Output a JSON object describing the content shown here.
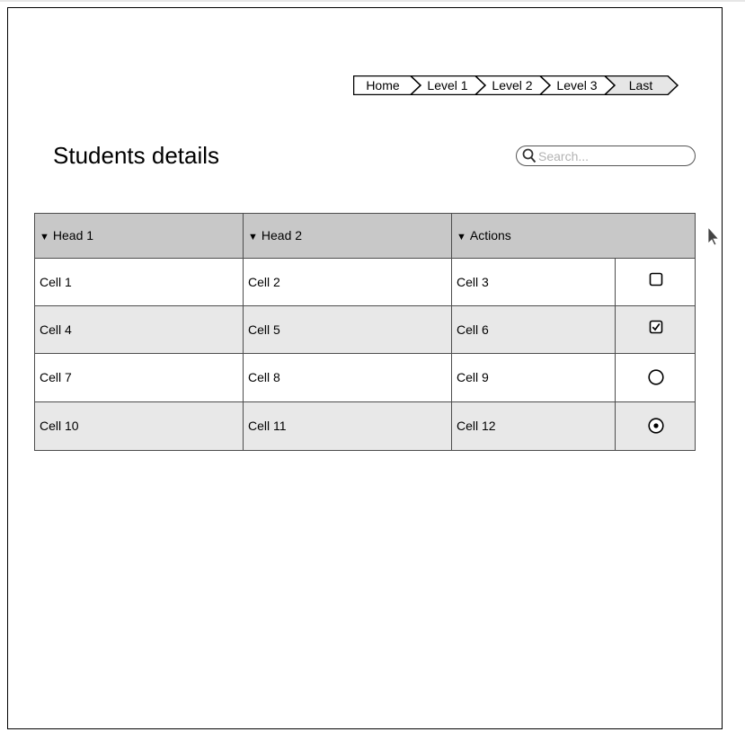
{
  "breadcrumb": {
    "items": [
      "Home",
      "Level 1",
      "Level 2",
      "Level 3",
      "Last"
    ]
  },
  "page": {
    "title": "Students details"
  },
  "search": {
    "placeholder": "Search...",
    "icon": "search-icon"
  },
  "table": {
    "headers": [
      "Head 1",
      "Head 2",
      "Actions"
    ],
    "header_icon": "sort-caret-icon",
    "rows": [
      {
        "cells": [
          "Cell 1",
          "Cell 2",
          "Cell 3"
        ],
        "control": "checkbox",
        "checked": false
      },
      {
        "cells": [
          "Cell 4",
          "Cell 5",
          "Cell 6"
        ],
        "control": "checkbox",
        "checked": true
      },
      {
        "cells": [
          "Cell 7",
          "Cell 8",
          "Cell 9"
        ],
        "control": "radio",
        "checked": false
      },
      {
        "cells": [
          "Cell 10",
          "Cell 11",
          "Cell 12"
        ],
        "control": "radio",
        "checked": true
      }
    ]
  },
  "colors": {
    "header_bg": "#c8c8c8",
    "alt_row_bg": "#e8e8e8",
    "border": "#4d4d4d",
    "last_crumb_bg": "#e6e6e6"
  }
}
